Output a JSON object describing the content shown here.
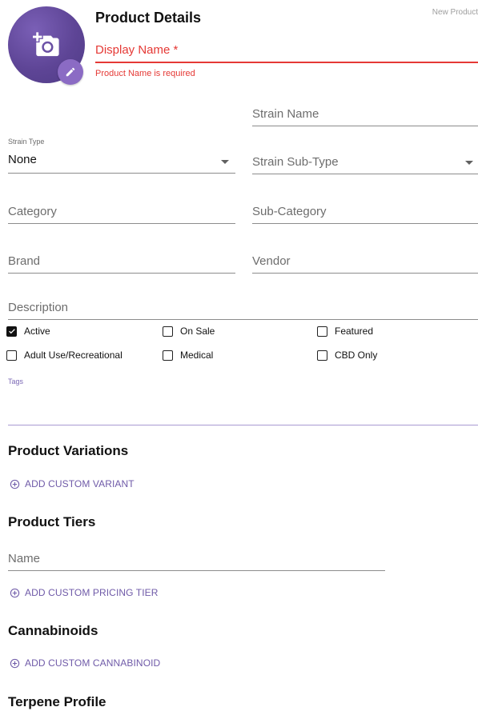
{
  "header": {
    "title": "Product Details",
    "new_product": "New Product"
  },
  "display_name": {
    "placeholder": "Display Name *",
    "error": "Product Name is required"
  },
  "fields": {
    "strain_name": "Strain Name",
    "strain_type_label": "Strain Type",
    "strain_type_value": "None",
    "strain_sub_type": "Strain Sub-Type",
    "category": "Category",
    "sub_category": "Sub-Category",
    "brand": "Brand",
    "vendor": "Vendor",
    "description": "Description",
    "tags_label": "Tags"
  },
  "checkboxes": [
    {
      "label": "Active",
      "checked": true
    },
    {
      "label": "On Sale",
      "checked": false
    },
    {
      "label": "Featured",
      "checked": false
    },
    {
      "label": "Adult Use/Recreational",
      "checked": false
    },
    {
      "label": "Medical",
      "checked": false
    },
    {
      "label": "CBD Only",
      "checked": false
    }
  ],
  "sections": {
    "variations": {
      "title": "Product Variations",
      "action": "ADD CUSTOM VARIANT"
    },
    "tiers": {
      "title": "Product Tiers",
      "name_placeholder": "Name",
      "action": "ADD CUSTOM PRICING TIER"
    },
    "cannabinoids": {
      "title": "Cannabinoids",
      "action": "ADD CUSTOM CANNABINOID"
    },
    "terpenes": {
      "title": "Terpene Profile"
    }
  },
  "colors": {
    "accent": "#6f5aa8",
    "error": "#e53935",
    "avatar": "#5e4596"
  },
  "icons": {
    "avatar": "add-photo-icon",
    "edit": "pencil-icon",
    "add": "add-circle-outline-icon",
    "dropdown": "caret-down-icon",
    "check": "check-icon"
  }
}
